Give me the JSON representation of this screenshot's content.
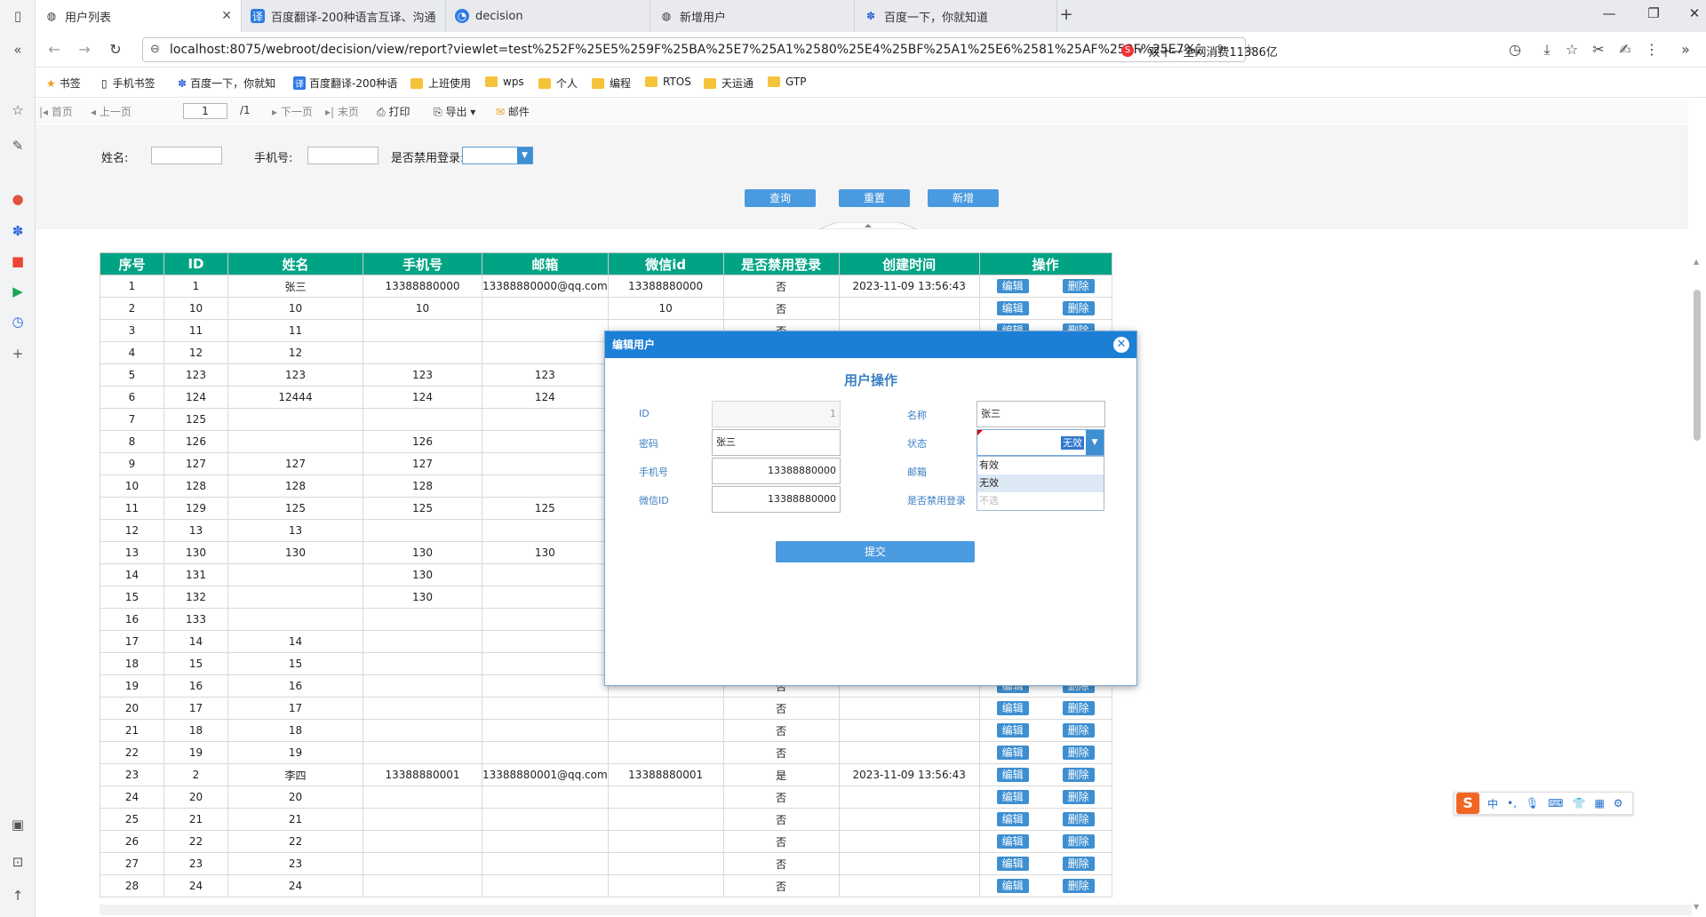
{
  "browser": {
    "tabs": [
      {
        "label": "用户列表",
        "active": true,
        "icon": "globe-icon"
      },
      {
        "label": "百度翻译-200种语言互译、沟通",
        "active": false,
        "icon": "translate-icon"
      },
      {
        "label": "decision",
        "active": false,
        "icon": "decision-icon"
      },
      {
        "label": "新增用户",
        "active": false,
        "icon": "globe-icon"
      },
      {
        "label": "百度一下，你就知道",
        "active": false,
        "icon": "baidu-paw-icon"
      }
    ],
    "url": "localhost:8075/webroot/decision/view/report?viewlet=test%252F%25E5%259F%25BA%25E7%25A1%2580%25E4%25BF%25A1%25E6%2581%25AF%252F%25E7%2594%25A",
    "ad_text": "双十一全网消费11386亿",
    "bookmarks": [
      "书签",
      "手机书签",
      "百度一下，你就知",
      "百度翻译-200种语",
      "上班使用",
      "wps",
      "个人",
      "编程",
      "RTOS",
      "天运通",
      "GTP"
    ]
  },
  "report_toolbar": {
    "first": "首页",
    "prev": "上一页",
    "page": "1",
    "total": "/1",
    "next": "下一页",
    "last": "末页",
    "print": "打印",
    "export": "导出",
    "mail": "邮件"
  },
  "filter": {
    "name_label": "姓名:",
    "phone_label": "手机号:",
    "disabled_label": "是否禁用登录:",
    "query_btn": "查询",
    "reset_btn": "重置",
    "add_btn": "新增"
  },
  "table": {
    "headers": [
      "序号",
      "ID",
      "姓名",
      "手机号",
      "邮箱",
      "微信id",
      "是否禁用登录",
      "创建时间",
      "操作"
    ],
    "edit_label": "编辑",
    "delete_label": "删除",
    "rows": [
      [
        "1",
        "1",
        "张三",
        "13388880000",
        "13388880000@qq.com",
        "13388880000",
        "否",
        "2023-11-09 13:56:43"
      ],
      [
        "2",
        "10",
        "10",
        "10",
        "",
        "10",
        "否",
        ""
      ],
      [
        "3",
        "11",
        "11",
        "",
        "",
        "",
        "否",
        ""
      ],
      [
        "4",
        "12",
        "12",
        "",
        "",
        "",
        "",
        ""
      ],
      [
        "5",
        "123",
        "123",
        "123",
        "123",
        "",
        "",
        ""
      ],
      [
        "6",
        "124",
        "12444",
        "124",
        "124",
        "",
        "",
        ""
      ],
      [
        "7",
        "125",
        "",
        "",
        "",
        "",
        "",
        ""
      ],
      [
        "8",
        "126",
        "",
        "126",
        "",
        "",
        "",
        ""
      ],
      [
        "9",
        "127",
        "127",
        "127",
        "",
        "",
        "",
        ""
      ],
      [
        "10",
        "128",
        "128",
        "128",
        "",
        "",
        "",
        ""
      ],
      [
        "11",
        "129",
        "125",
        "125",
        "125",
        "",
        "",
        ""
      ],
      [
        "12",
        "13",
        "13",
        "",
        "",
        "",
        "",
        ""
      ],
      [
        "13",
        "130",
        "130",
        "130",
        "130",
        "",
        "",
        ""
      ],
      [
        "14",
        "131",
        "",
        "130",
        "",
        "",
        "",
        ""
      ],
      [
        "15",
        "132",
        "",
        "130",
        "",
        "",
        "",
        ""
      ],
      [
        "16",
        "133",
        "",
        "",
        "",
        "",
        "",
        ""
      ],
      [
        "17",
        "14",
        "14",
        "",
        "",
        "",
        "",
        ""
      ],
      [
        "18",
        "15",
        "15",
        "",
        "",
        "",
        "",
        ""
      ],
      [
        "19",
        "16",
        "16",
        "",
        "",
        "",
        "否",
        ""
      ],
      [
        "20",
        "17",
        "17",
        "",
        "",
        "",
        "否",
        ""
      ],
      [
        "21",
        "18",
        "18",
        "",
        "",
        "",
        "否",
        ""
      ],
      [
        "22",
        "19",
        "19",
        "",
        "",
        "",
        "否",
        ""
      ],
      [
        "23",
        "2",
        "李四",
        "13388880001",
        "13388880001@qq.com",
        "13388880001",
        "是",
        "2023-11-09 13:56:43"
      ],
      [
        "24",
        "20",
        "20",
        "",
        "",
        "",
        "否",
        ""
      ],
      [
        "25",
        "21",
        "21",
        "",
        "",
        "",
        "否",
        ""
      ],
      [
        "26",
        "22",
        "22",
        "",
        "",
        "",
        "否",
        ""
      ],
      [
        "27",
        "23",
        "23",
        "",
        "",
        "",
        "否",
        ""
      ],
      [
        "28",
        "24",
        "24",
        "",
        "",
        "",
        "否",
        ""
      ]
    ]
  },
  "modal": {
    "header": "编辑用户",
    "title": "用户操作",
    "id_label": "ID",
    "id_value": "1",
    "name_label": "名称",
    "name_value": "张三",
    "password_label": "密码",
    "password_value": "张三",
    "status_label": "状态",
    "status_value": "无效",
    "phone_label": "手机号",
    "phone_value": "13388880000",
    "email_label": "邮箱",
    "wechat_label": "微信ID",
    "wechat_value": "13388880000",
    "disabled_label": "是否禁用登录",
    "status_options": [
      "有效",
      "无效",
      "不选"
    ],
    "submit": "提交"
  },
  "ime": {
    "logo": "S",
    "mode": "中",
    "punct": "•,"
  },
  "colors": {
    "header_green": "#00a485",
    "button_blue": "#3d8fd1",
    "modal_header": "#1c7fd6"
  }
}
